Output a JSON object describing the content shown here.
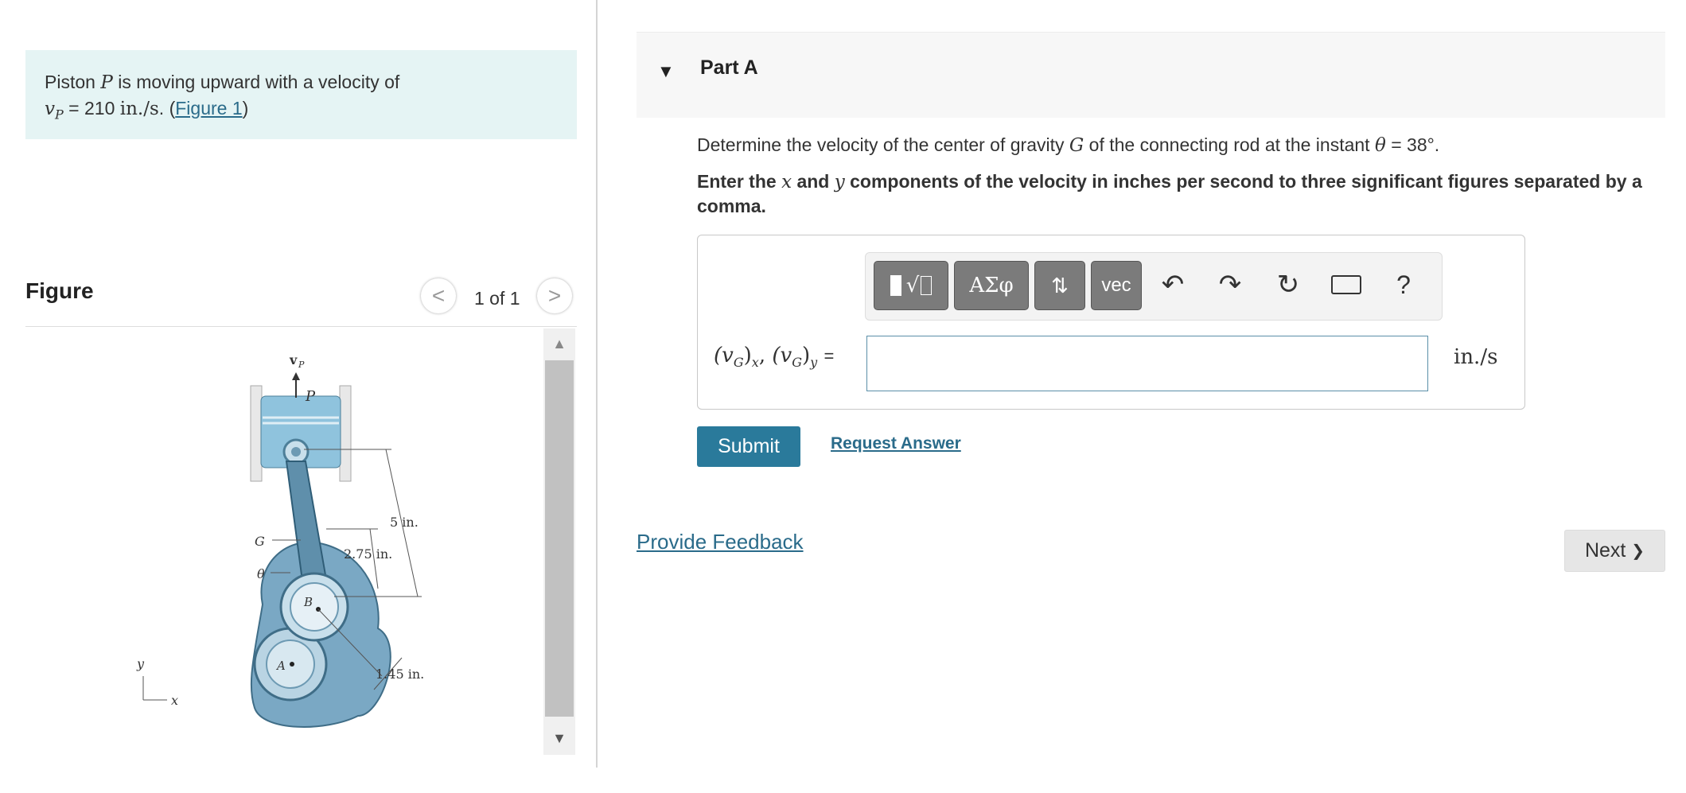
{
  "problem": {
    "intro": "Piston",
    "piston_symbol": "P",
    "rest": "is moving upward with a velocity of",
    "velocity_symbol": "v",
    "velocity_subscript": "P",
    "equals": "=",
    "value": "210",
    "unit": "in./s",
    "open_paren": ". (",
    "figure_link": "Figure 1",
    "close_paren": ")"
  },
  "figure": {
    "title": "Figure",
    "counter": "1 of 1",
    "prev_glyph": "<",
    "next_glyph": ">",
    "labels": {
      "vp": "v",
      "vp_sub": "P",
      "p": "P",
      "g": "G",
      "theta": "θ",
      "b": "B",
      "a": "A",
      "dim_5": "5 in.",
      "dim_275": "2.75 in.",
      "dim_145": "1.45 in.",
      "axis_y": "y",
      "axis_x": "x"
    }
  },
  "part": {
    "title": "Part A",
    "question_pre": "Determine the velocity of the center of gravity",
    "question_symbol": "G",
    "question_mid": "of the connecting rod at the instant",
    "theta_symbol": "θ",
    "question_value": "= 38°.",
    "instruction_1": "Enter the",
    "instruction_x": "x",
    "instruction_2": "and",
    "instruction_y": "y",
    "instruction_3": "components of the velocity in inches per second to three significant figures separated by a comma."
  },
  "toolbar": {
    "templates_label": "√",
    "greek_label": "AΣφ",
    "arrows_label": "⇅",
    "vec_label": "vec",
    "undo_icon": "undo-icon",
    "redo_icon": "redo-icon",
    "reset_icon": "reset-icon",
    "keyboard_icon": "keyboard-icon",
    "help_label": "?"
  },
  "answer": {
    "label_open": "(v",
    "label_sub_g": "G",
    "label_x": "x",
    "label_y": "y",
    "label_equals": "=",
    "input_value": "",
    "unit": "in./s"
  },
  "actions": {
    "submit": "Submit",
    "request_answer": "Request Answer",
    "feedback": "Provide Feedback",
    "next": "Next",
    "next_glyph": "❯"
  },
  "colors": {
    "problem_bg": "#e5f4f4",
    "accent": "#2a7a9b",
    "link": "#2a6b8a",
    "piston_blue": "#8fc3dd",
    "crank_blue": "#7aa8c4"
  }
}
